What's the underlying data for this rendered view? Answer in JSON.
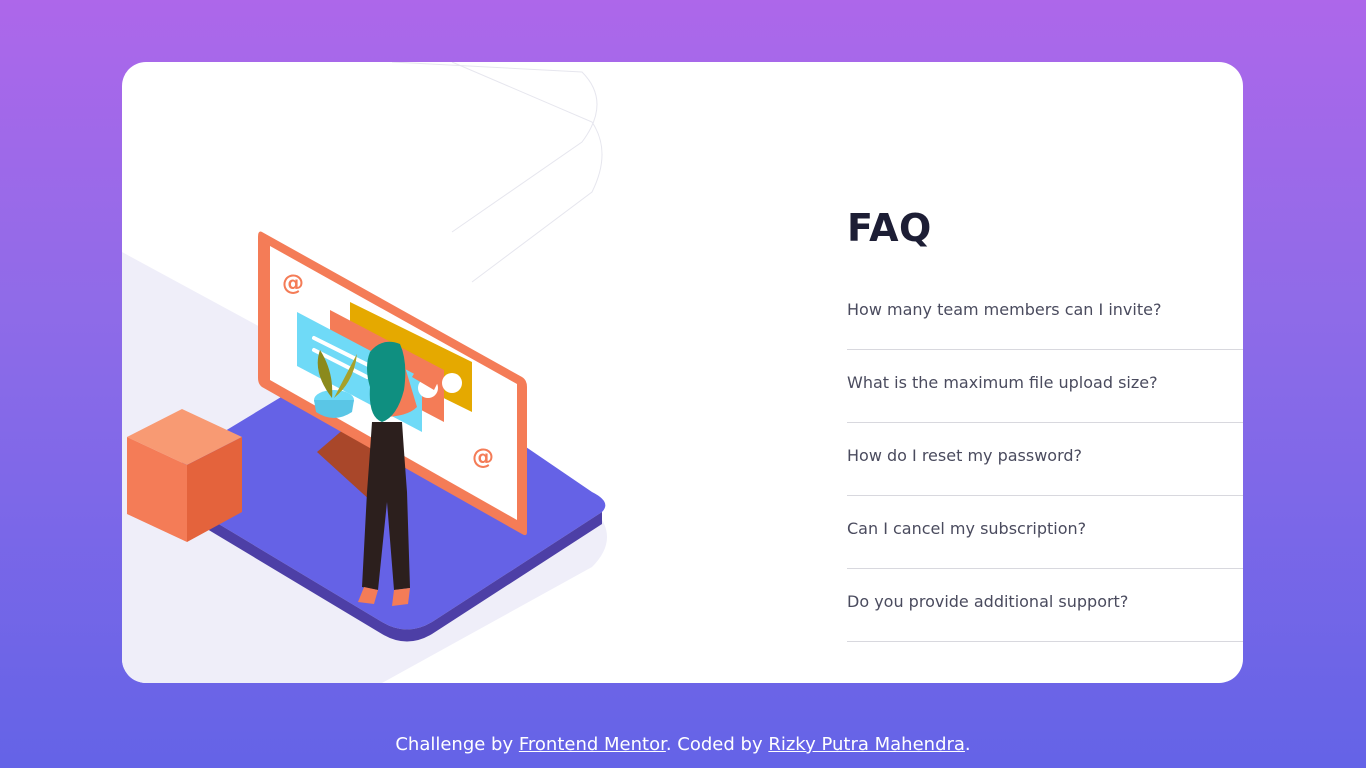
{
  "faq": {
    "title": "FAQ",
    "items": [
      {
        "question": "How many team members can I invite?"
      },
      {
        "question": "What is the maximum file upload size?"
      },
      {
        "question": "How do I reset my password?"
      },
      {
        "question": "Can I cancel my subscription?"
      },
      {
        "question": "Do you provide additional support?"
      }
    ]
  },
  "footer": {
    "prefix": "Challenge by ",
    "link1": "Frontend Mentor",
    "middle": ". Coded by ",
    "link2": "Rizky Putra Mahendra",
    "suffix": "."
  },
  "illustration": {
    "icons": [
      "at-sign-icon",
      "plant-icon",
      "monitor-icon",
      "person-icon",
      "cube-icon"
    ]
  },
  "colors": {
    "accent": "#f47c57",
    "title": "#1d1e35",
    "text": "#4a4b5e",
    "platform": "#6562e6"
  }
}
